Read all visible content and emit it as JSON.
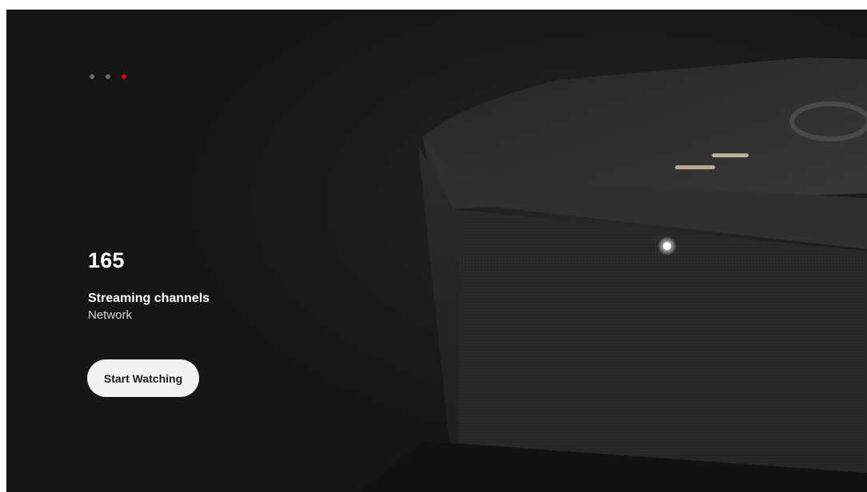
{
  "carousel": {
    "slide_count": 3,
    "active_index": 2
  },
  "hero": {
    "count": "165",
    "title": "Streaming channels",
    "provider": "Network",
    "cta_label": "Start Watching",
    "image": "streaming-box-device"
  },
  "colors": {
    "background": "#161616",
    "accent": "#e60000",
    "button_bg": "#f2f2f2",
    "button_text": "#1a1a1a",
    "device_led": "#ffffff"
  }
}
